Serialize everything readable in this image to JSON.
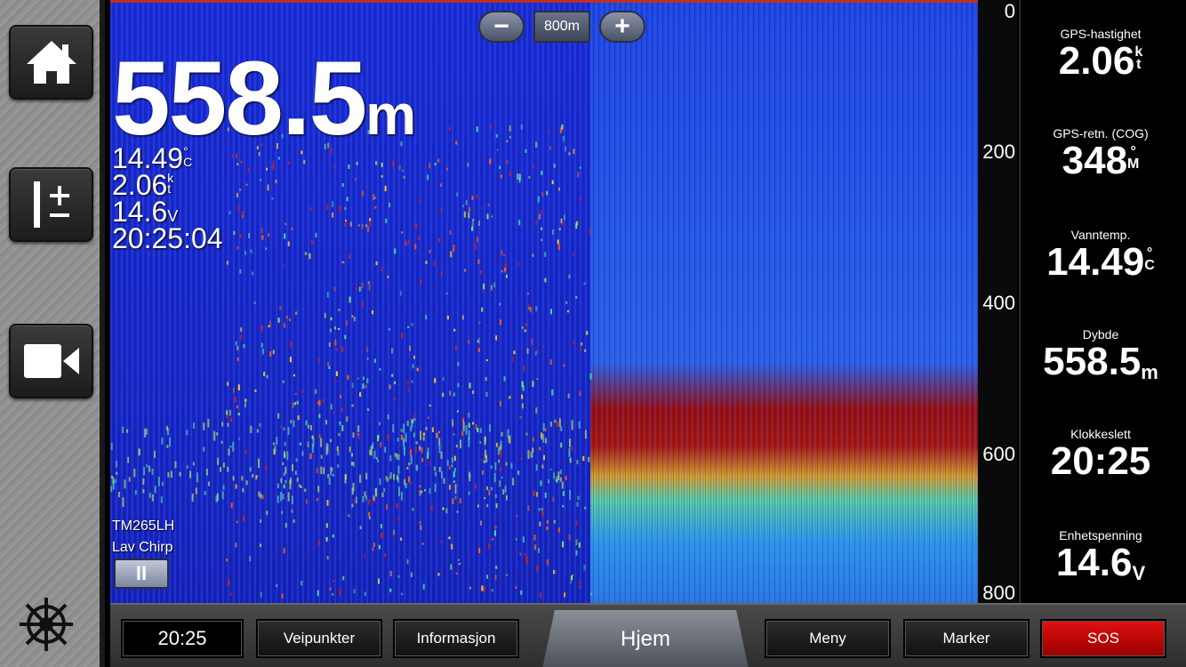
{
  "sidebar": {
    "home_icon": "home-icon",
    "range_icon": "plus-minus-range-icon",
    "camera_icon": "video-camera-icon",
    "helm_icon": "ship-wheel-icon"
  },
  "zoom": {
    "minus_label": "−",
    "range_label": "800m",
    "plus_label": "+"
  },
  "overlay": {
    "depth_value": "558.5",
    "depth_unit": "m",
    "temp_value": "14.49",
    "temp_unit_top": "°",
    "temp_unit_bottom": "C",
    "speed_value": "2.06",
    "speed_unit_top": "k",
    "speed_unit_bottom": "t",
    "voltage_value": "14.6",
    "voltage_unit": "V",
    "time": "20:25:04",
    "transducer": "TM265LH",
    "mode": "Lav Chirp",
    "pause_label": "II"
  },
  "depth_scale": {
    "ticks": [
      "0",
      "200",
      "400",
      "600",
      "800"
    ]
  },
  "data_fields": [
    {
      "label": "GPS-hastighet",
      "value": "2.06",
      "unit_top": "k",
      "unit_bottom": "t"
    },
    {
      "label": "GPS-retn. (COG)",
      "value": "348",
      "unit_top": "°",
      "unit_bottom": "M"
    },
    {
      "label": "Vanntemp.",
      "value": "14.49",
      "unit_top": "°",
      "unit_bottom": "C"
    },
    {
      "label": "Dybde",
      "value": "558.5",
      "unit": "m"
    },
    {
      "label": "Klokkeslett",
      "value": "20:25"
    },
    {
      "label": "Enhetspenning",
      "value": "14.6",
      "unit": "V"
    }
  ],
  "bottom_bar": {
    "clock": "20:25",
    "waypoints": "Veipunkter",
    "info": "Informasjon",
    "home": "Hjem",
    "menu": "Meny",
    "marker": "Marker",
    "sos": "SOS"
  },
  "colors": {
    "sonar_background": "#1a2ad0",
    "bottom_echo": "#b01000",
    "sos_red": "#d00000"
  }
}
